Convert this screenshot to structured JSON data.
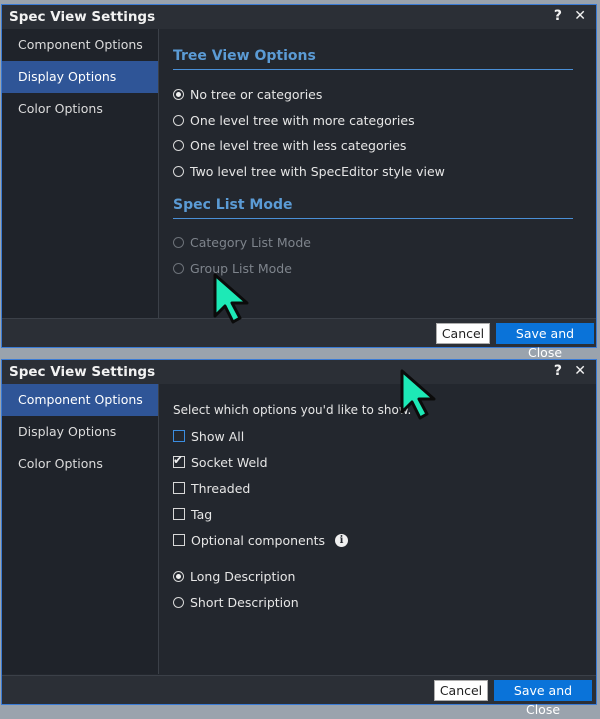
{
  "dialog1": {
    "title": "Spec View Settings",
    "help_label": "?",
    "close_label": "✕",
    "nav": [
      {
        "label": "Component Options",
        "active": false
      },
      {
        "label": "Display Options",
        "active": true
      },
      {
        "label": "Color Options",
        "active": false
      }
    ],
    "tree_view": {
      "heading": "Tree View Options",
      "options": [
        {
          "label": "No tree or categories",
          "selected": true
        },
        {
          "label": "One level tree with more categories",
          "selected": false
        },
        {
          "label": "One level tree with less categories",
          "selected": false
        },
        {
          "label": "Two level tree with SpecEditor style view",
          "selected": false
        }
      ]
    },
    "spec_list": {
      "heading": "Spec List Mode",
      "options": [
        {
          "label": "Category List Mode",
          "selected": false,
          "disabled": true
        },
        {
          "label": "Group List Mode",
          "selected": false,
          "disabled": true
        }
      ]
    },
    "buttons": {
      "cancel": "Cancel",
      "save": "Save and Close"
    }
  },
  "dialog2": {
    "title": "Spec View Settings",
    "help_label": "?",
    "close_label": "✕",
    "nav": [
      {
        "label": "Component Options",
        "active": true
      },
      {
        "label": "Display Options",
        "active": false
      },
      {
        "label": "Color Options",
        "active": false
      }
    ],
    "intro": "Select which options you'd like to show.",
    "checkboxes": [
      {
        "label": "Show All",
        "checked": false
      },
      {
        "label": "Socket Weld",
        "checked": true
      },
      {
        "label": "Threaded",
        "checked": false
      },
      {
        "label": "Tag",
        "checked": false
      },
      {
        "label": "Optional components",
        "checked": false
      }
    ],
    "info_glyph": "i",
    "description": [
      {
        "label": "Long Description",
        "selected": true
      },
      {
        "label": "Short Description",
        "selected": false
      }
    ],
    "buttons": {
      "cancel": "Cancel",
      "save": "Save and Close"
    }
  },
  "colors": {
    "accent": "#3a7bd5",
    "cursor_fill": "#1de9b6",
    "save_button": "#0a73d9"
  }
}
